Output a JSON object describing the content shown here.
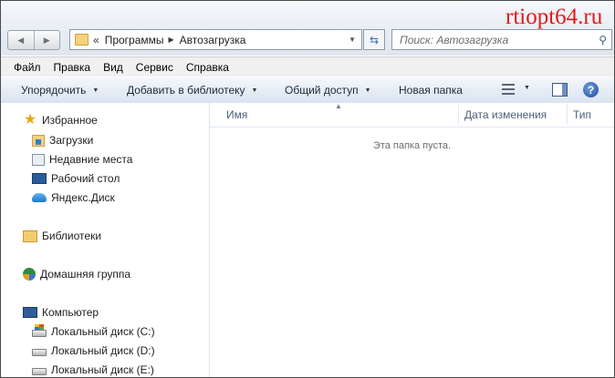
{
  "watermark": "rtiopt64.ru",
  "address": {
    "overflow": "«",
    "crumbs": [
      "Программы",
      "Автозагрузка"
    ]
  },
  "search": {
    "placeholder": "Поиск: Автозагрузка"
  },
  "menu": [
    "Файл",
    "Правка",
    "Вид",
    "Сервис",
    "Справка"
  ],
  "toolbar": {
    "organize": "Упорядочить",
    "add_library": "Добавить в библиотеку",
    "share": "Общий доступ",
    "new_folder": "Новая папка"
  },
  "nav": {
    "favorites": "Избранное",
    "downloads": "Загрузки",
    "recent": "Недавние места",
    "desktop": "Рабочий стол",
    "yandex": "Яндекс.Диск",
    "libraries": "Библиотеки",
    "homegroup": "Домашняя группа",
    "computer": "Компьютер",
    "disk_c": "Локальный диск (C:)",
    "disk_d": "Локальный диск (D:)",
    "disk_e": "Локальный диск (E:)"
  },
  "columns": {
    "name": "Имя",
    "date": "Дата изменения",
    "type": "Тип"
  },
  "empty_message": "Эта папка пуста."
}
